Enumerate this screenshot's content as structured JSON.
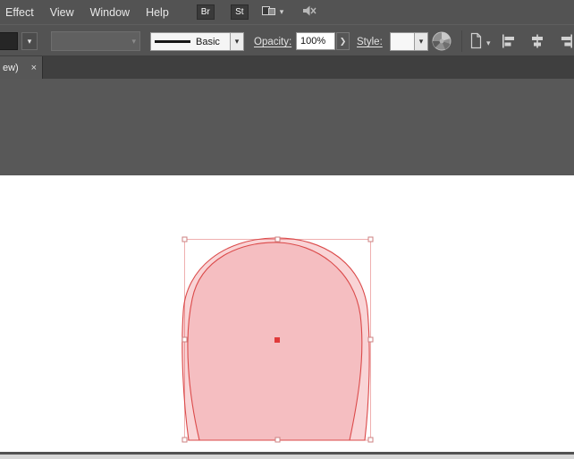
{
  "icons": {
    "chevron_down": "▾",
    "chevron_right": "❯"
  },
  "menu_bar": {
    "items": [
      "Effect",
      "View",
      "Window",
      "Help"
    ],
    "brushes_button": "Br",
    "stroke_button": "St"
  },
  "control_bar": {
    "stroke_style": "Basic",
    "opacity_label": "Opacity:",
    "opacity_value": "100%",
    "style_label": "Style:"
  },
  "tab_bar": {
    "active_tab_label": "ew)",
    "close_glyph": "×"
  },
  "canvas": {
    "selected_object": "dome-shape",
    "colors": {
      "ui_gray": "#535353",
      "selection_bbox": "#efb0b0",
      "shape_stroke": "#db4a4a",
      "shape_fill_single": "#f8d4d6",
      "center_point": "#e03a3a"
    }
  }
}
